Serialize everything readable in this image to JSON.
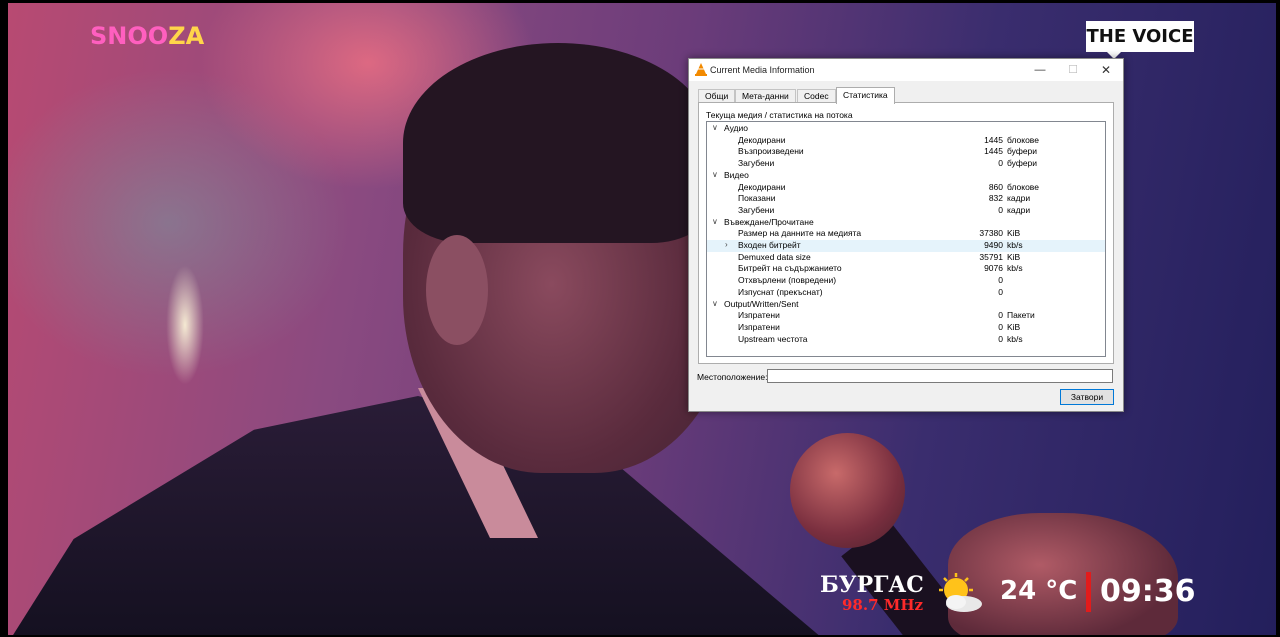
{
  "overlay": {
    "brand_left": [
      "SNOO",
      "ZA"
    ],
    "brand_right": "THE VOICE",
    "city": "БУРГАС",
    "frequency": "98.7 MHz",
    "weather_icon": "partly-cloudy-icon",
    "temperature": "24 °C",
    "time": "09:36"
  },
  "dialog": {
    "title": "Current Media Information",
    "tabs": [
      "Общи",
      "Мета-данни",
      "Codec",
      "Статистика"
    ],
    "active_tab": "Статистика",
    "panel_heading": "Текуща медия / статистика на потока",
    "categories": {
      "audio": "Аудио",
      "video": "Видео",
      "input": "Въвеждане/Прочитане",
      "output": "Output/Written/Sent"
    },
    "rows": [
      {
        "label": "Декодирани",
        "value": "1445",
        "unit": "блокове"
      },
      {
        "label": "Възпроизведени",
        "value": "1445",
        "unit": "буфери"
      },
      {
        "label": "Загубени",
        "value": "0",
        "unit": "буфери"
      },
      {
        "label": "Декодирани",
        "value": "860",
        "unit": "блокове"
      },
      {
        "label": "Показани",
        "value": "832",
        "unit": "кадри"
      },
      {
        "label": "Загубени",
        "value": "0",
        "unit": "кадри"
      },
      {
        "label": "Размер на данните на медията",
        "value": "37380",
        "unit": "KiB"
      },
      {
        "label": "Входен битрейт",
        "value": "9490",
        "unit": "kb/s"
      },
      {
        "label": "Demuxed data size",
        "value": "35791",
        "unit": "KiB"
      },
      {
        "label": "Битрейт на съдържанието",
        "value": "9076",
        "unit": "kb/s"
      },
      {
        "label": "Отхвърлени (повредени)",
        "value": "0",
        "unit": ""
      },
      {
        "label": "Изпуснат (прекъснат)",
        "value": "0",
        "unit": ""
      },
      {
        "label": "Изпратени",
        "value": "0",
        "unit": "Пакети"
      },
      {
        "label": "Изпратени",
        "value": "0",
        "unit": "KiB"
      },
      {
        "label": "Upstream честота",
        "value": "0",
        "unit": "kb/s"
      }
    ],
    "location_label": "Местоположение:",
    "location_value": "",
    "close_label": "Затвори"
  }
}
